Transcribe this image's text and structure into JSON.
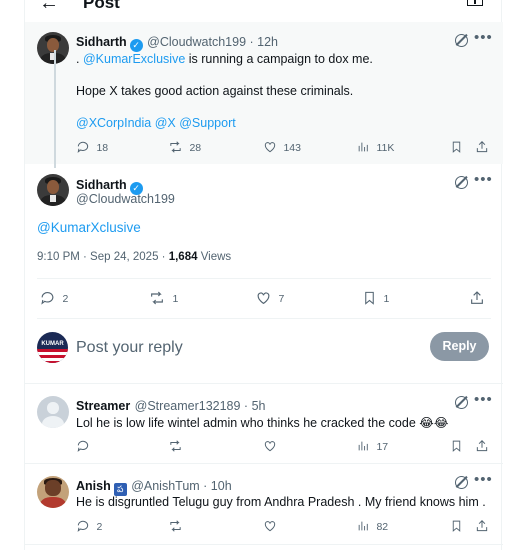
{
  "header": {
    "title": "Post",
    "back_icon": "arrow-left-icon",
    "reader_icon": "reader-mode-icon"
  },
  "parent_post": {
    "author_name": "Sidharth",
    "handle_time": "@Cloudwatch199 · 12h",
    "line1_prefix": ".",
    "line1_mention": "@KumarExclusive",
    "line1_rest": "is running a campaign to dox me.",
    "line2": "Hope X takes good action against these criminals.",
    "mentions": [
      "@XCorpIndia",
      "@X",
      "@Support"
    ],
    "replies": "18",
    "reposts": "28",
    "likes": "143",
    "views": "11K"
  },
  "main_post": {
    "author_name": "Sidharth",
    "handle": "@Cloudwatch199",
    "text": "@KumarXclusive",
    "time": "9:10 PM · Sep 24, 2025 ·",
    "views_count": "1,684",
    "views_label": "Views",
    "replies": "2",
    "reposts": "1",
    "likes": "7",
    "bookmarks": "1"
  },
  "composer": {
    "avatar_text": "KUMAR",
    "placeholder": "Post your reply",
    "reply_label": "Reply"
  },
  "replies": [
    {
      "author_name": "Streamer",
      "handle_time": "@Streamer132189 · 5h",
      "text": "Lol he is low life wintel admin who thinks he cracked the code 😂😂",
      "views": "17"
    },
    {
      "author_name": "Anish",
      "badge": "ప",
      "handle_time": "@AnishTum · 10h",
      "text": "He is disgruntled Telugu guy from Andhra Pradesh . My friend knows him .",
      "replies": "2",
      "views": "82"
    }
  ],
  "colors": {
    "link": "#1d9bf0",
    "muted": "#536471",
    "reply_button": "#8b98a5"
  }
}
